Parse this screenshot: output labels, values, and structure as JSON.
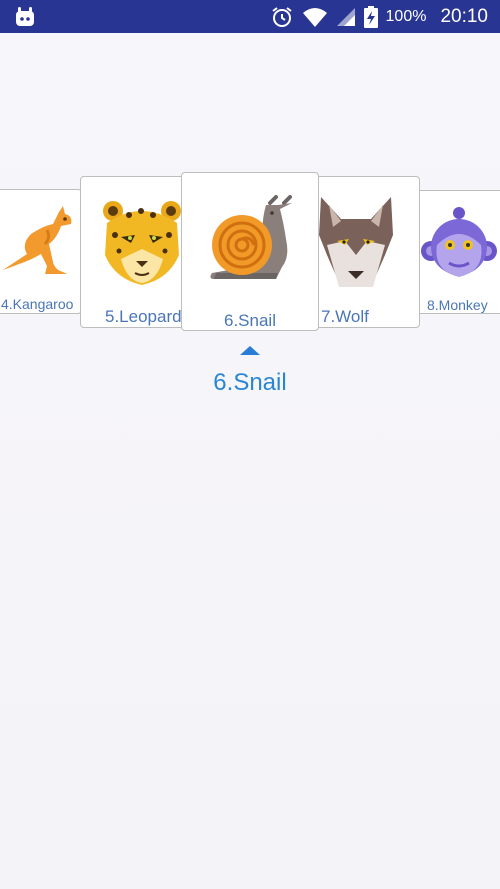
{
  "status_bar": {
    "battery_percent": "100%",
    "time": "20:10",
    "left_icon": "android-notification-icon",
    "icons": [
      "alarm-icon",
      "wifi-icon",
      "cell-signal-icon",
      "battery-charging-icon"
    ]
  },
  "carousel": {
    "items": [
      {
        "label": "4.Kangaroo",
        "icon": "kangaroo-icon"
      },
      {
        "label": "5.Leopard",
        "icon": "leopard-icon"
      },
      {
        "label": "6.Snail",
        "icon": "snail-icon"
      },
      {
        "label": "7.Wolf",
        "icon": "wolf-icon"
      },
      {
        "label": "8.Monkey",
        "icon": "monkey-icon"
      }
    ],
    "selected_index": 2
  },
  "selection": {
    "label": "6.Snail",
    "pointer_icon": "pointer-up-icon"
  },
  "colors": {
    "status_bar": "#283593",
    "label_text": "#4a76b8",
    "accent": "#2a86d4"
  }
}
